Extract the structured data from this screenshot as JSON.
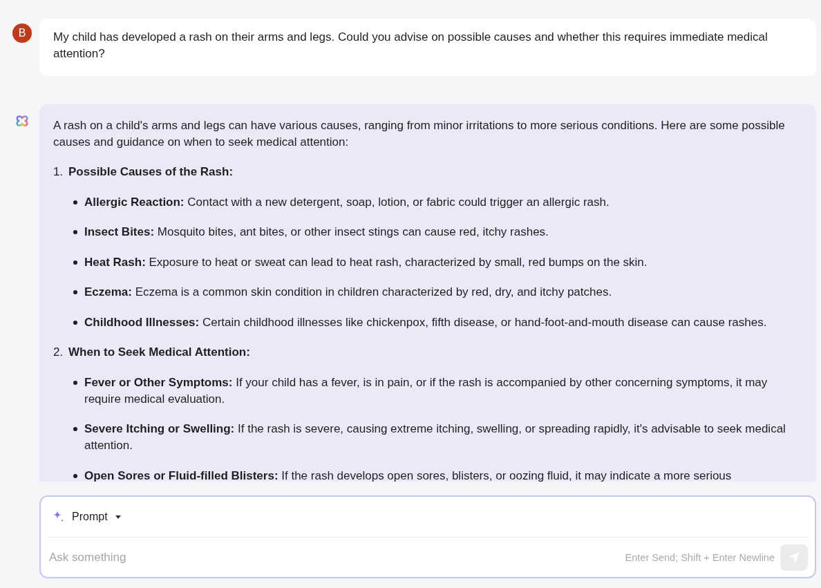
{
  "user_message": {
    "avatar_letter": "B",
    "text": "My child has developed a rash on their arms and legs. Could you advise on possible causes and whether this requires immediate medical attention?"
  },
  "assistant_message": {
    "intro": "A rash on a child's arms and legs can have various causes, ranging from minor irritations to more serious conditions. Here are some possible causes and guidance on when to seek medical attention:",
    "sections": [
      {
        "number": "1.",
        "heading": "Possible Causes of the Rash:",
        "items": [
          "**Allergic Reaction:** Contact with a new detergent, soap, lotion, or fabric could trigger an allergic rash.",
          "**Insect Bites:** Mosquito bites, ant bites, or other insect stings can cause red, itchy rashes.",
          "**Heat Rash:** Exposure to heat or sweat can lead to heat rash, characterized by small, red bumps on the skin.",
          "**Eczema:** Eczema is a common skin condition in children characterized by red, dry, and itchy patches.",
          "**Childhood Illnesses:** Certain childhood illnesses like chickenpox, fifth disease, or hand-foot-and-mouth disease can cause rashes."
        ]
      },
      {
        "number": "2.",
        "heading": "When to Seek Medical Attention:",
        "items": [
          "**Fever or Other Symptoms:** If your child has a fever, is in pain, or if the rash is accompanied by other concerning symptoms, it may require medical evaluation.",
          "**Severe Itching or Swelling:** If the rash is severe, causing extreme itching, swelling, or spreading rapidly, it's advisable to seek medical attention.",
          "**Open Sores or Fluid-filled Blisters:** If the rash develops open sores, blisters, or oozing fluid, it may indicate a more serious"
        ]
      }
    ]
  },
  "composer": {
    "mode": "Prompt",
    "placeholder": "Ask something",
    "hint": "Enter Send; Shift + Enter Newline",
    "send_disabled": true
  }
}
